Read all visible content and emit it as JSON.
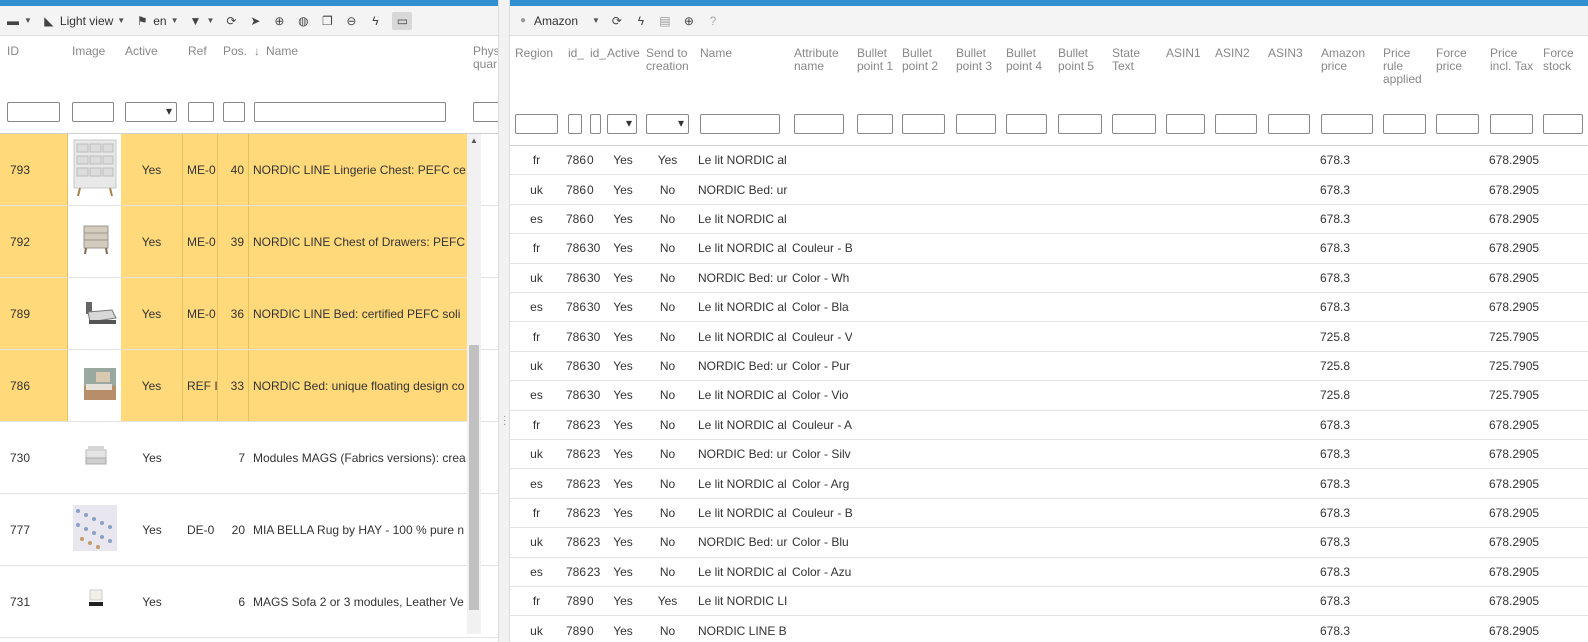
{
  "left_toolbar": {
    "view_label": "Light view",
    "lang_label": "en",
    "icons": [
      "layout-icon",
      "view-mode-icon",
      "flag-icon",
      "filter-icon",
      "refresh-icon",
      "cursor-icon",
      "add-icon",
      "globe-icon",
      "copy-icon",
      "remove-icon",
      "lightning-icon",
      "folder-icon"
    ]
  },
  "left_headers": {
    "id": "ID",
    "image": "Image",
    "active": "Active",
    "ref": "Ref",
    "pos": "Pos.",
    "sort_icon": "↓",
    "name": "Name",
    "phys": "Phys quar"
  },
  "left_rows": [
    {
      "id": "793",
      "active": "Yes",
      "ref": "ME-0",
      "pos": "40",
      "name": "NORDIC LINE Lingerie Chest: PEFC ce",
      "selected": true,
      "thumb": "chest"
    },
    {
      "id": "792",
      "active": "Yes",
      "ref": "ME-0",
      "pos": "39",
      "name": "NORDIC LINE Chest of Drawers: PEFC",
      "selected": true,
      "thumb": "drawers"
    },
    {
      "id": "789",
      "active": "Yes",
      "ref": "ME-0",
      "pos": "36",
      "name": "NORDIC LINE Bed: certified PEFC soli",
      "selected": true,
      "thumb": "bed"
    },
    {
      "id": "786",
      "active": "Yes",
      "ref": "REF I",
      "pos": "33",
      "name": "NORDIC Bed: unique floating design co",
      "selected": true,
      "thumb": "room"
    },
    {
      "id": "730",
      "active": "Yes",
      "ref": "",
      "pos": "7",
      "name": "Modules MAGS (Fabrics versions): crea",
      "selected": false,
      "thumb": "module"
    },
    {
      "id": "777",
      "active": "Yes",
      "ref": "DE-0",
      "pos": "20",
      "name": "MIA BELLA Rug by HAY - 100 % pure n",
      "selected": false,
      "thumb": "rug"
    },
    {
      "id": "731",
      "active": "Yes",
      "ref": "",
      "pos": "6",
      "name": "MAGS Sofa 2 or 3 modules, Leather Ve",
      "selected": false,
      "thumb": "sofa"
    }
  ],
  "right_toolbar": {
    "marketplace_label": "Amazon",
    "icons": [
      "amazon-icon",
      "refresh-icon",
      "lightning-icon",
      "document-icon",
      "add-icon",
      "help-icon"
    ]
  },
  "right_headers": {
    "region": "Region",
    "id1": "id_",
    "id2": "id_",
    "active": "Active",
    "send": "Send to creation",
    "name": "Name",
    "attr": "Attribute name",
    "bp1": "Bullet point 1",
    "bp2": "Bullet point 2",
    "bp3": "Bullet point 3",
    "bp4": "Bullet point 4",
    "bp5": "Bullet point 5",
    "state": "State Text",
    "asin1": "ASIN1",
    "asin2": "ASIN2",
    "asin3": "ASIN3",
    "amazon_price": "Amazon price",
    "price_rule": "Price rule applied",
    "force_price": "Force price",
    "price_incl": "Price incl. Tax",
    "force_stock": "Force stock"
  },
  "right_rows": [
    {
      "region": "fr",
      "id1": "786",
      "id2": "0",
      "active": "Yes",
      "send": "Yes",
      "name": "Le lit NORDIC al",
      "attr": "",
      "amazon_price": "678.3",
      "price_incl": "678.2905"
    },
    {
      "region": "uk",
      "id1": "786",
      "id2": "0",
      "active": "Yes",
      "send": "No",
      "name": "NORDIC Bed: ur",
      "attr": "",
      "amazon_price": "678.3",
      "price_incl": "678.2905"
    },
    {
      "region": "es",
      "id1": "786",
      "id2": "0",
      "active": "Yes",
      "send": "No",
      "name": "Le lit NORDIC al",
      "attr": "",
      "amazon_price": "678.3",
      "price_incl": "678.2905"
    },
    {
      "region": "fr",
      "id1": "786",
      "id2": "30",
      "active": "Yes",
      "send": "No",
      "name": "Le lit NORDIC al",
      "attr": "Couleur - B",
      "amazon_price": "678.3",
      "price_incl": "678.2905"
    },
    {
      "region": "uk",
      "id1": "786",
      "id2": "30",
      "active": "Yes",
      "send": "No",
      "name": "NORDIC Bed: ur",
      "attr": "Color - Wh",
      "amazon_price": "678.3",
      "price_incl": "678.2905"
    },
    {
      "region": "es",
      "id1": "786",
      "id2": "30",
      "active": "Yes",
      "send": "No",
      "name": "Le lit NORDIC al",
      "attr": "Color - Bla",
      "amazon_price": "678.3",
      "price_incl": "678.2905"
    },
    {
      "region": "fr",
      "id1": "786",
      "id2": "30",
      "active": "Yes",
      "send": "No",
      "name": "Le lit NORDIC al",
      "attr": "Couleur - V",
      "amazon_price": "725.8",
      "price_incl": "725.7905"
    },
    {
      "region": "uk",
      "id1": "786",
      "id2": "30",
      "active": "Yes",
      "send": "No",
      "name": "NORDIC Bed: ur",
      "attr": "Color - Pur",
      "amazon_price": "725.8",
      "price_incl": "725.7905"
    },
    {
      "region": "es",
      "id1": "786",
      "id2": "30",
      "active": "Yes",
      "send": "No",
      "name": "Le lit NORDIC al",
      "attr": "Color - Vio",
      "amazon_price": "725.8",
      "price_incl": "725.7905"
    },
    {
      "region": "fr",
      "id1": "786",
      "id2": "23",
      "active": "Yes",
      "send": "No",
      "name": "Le lit NORDIC al",
      "attr": "Couleur - A",
      "amazon_price": "678.3",
      "price_incl": "678.2905"
    },
    {
      "region": "uk",
      "id1": "786",
      "id2": "23",
      "active": "Yes",
      "send": "No",
      "name": "NORDIC Bed: ur",
      "attr": "Color - Silv",
      "amazon_price": "678.3",
      "price_incl": "678.2905"
    },
    {
      "region": "es",
      "id1": "786",
      "id2": "23",
      "active": "Yes",
      "send": "No",
      "name": "Le lit NORDIC al",
      "attr": "Color - Arg",
      "amazon_price": "678.3",
      "price_incl": "678.2905"
    },
    {
      "region": "fr",
      "id1": "786",
      "id2": "23",
      "active": "Yes",
      "send": "No",
      "name": "Le lit NORDIC al",
      "attr": "Couleur - B",
      "amazon_price": "678.3",
      "price_incl": "678.2905"
    },
    {
      "region": "uk",
      "id1": "786",
      "id2": "23",
      "active": "Yes",
      "send": "No",
      "name": "NORDIC Bed: ur",
      "attr": "Color - Blu",
      "amazon_price": "678.3",
      "price_incl": "678.2905"
    },
    {
      "region": "es",
      "id1": "786",
      "id2": "23",
      "active": "Yes",
      "send": "No",
      "name": "Le lit NORDIC al",
      "attr": "Color - Azu",
      "amazon_price": "678.3",
      "price_incl": "678.2905"
    },
    {
      "region": "fr",
      "id1": "789",
      "id2": "0",
      "active": "Yes",
      "send": "Yes",
      "name": "Le lit NORDIC LI",
      "attr": "",
      "amazon_price": "678.3",
      "price_incl": "678.2905"
    },
    {
      "region": "uk",
      "id1": "789",
      "id2": "0",
      "active": "Yes",
      "send": "No",
      "name": "NORDIC LINE B",
      "attr": "",
      "amazon_price": "678.3",
      "price_incl": "678.2905"
    }
  ],
  "colors": {
    "selected_row": "#ffd97a",
    "top_accent": "#2f8fd0"
  }
}
